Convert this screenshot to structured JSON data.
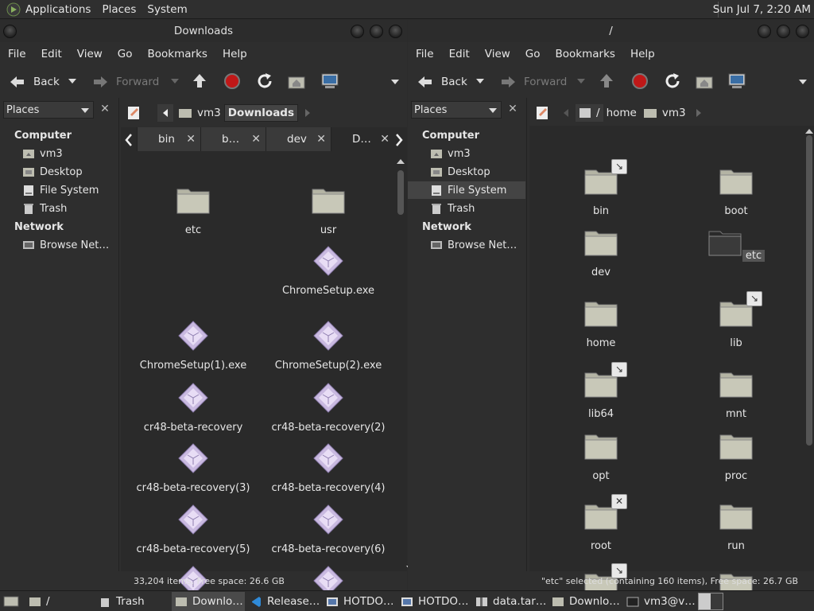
{
  "topbar": {
    "menus": [
      "Applications",
      "Places",
      "System"
    ],
    "clock": "Sun Jul  7,  2:20 AM"
  },
  "left": {
    "title": "Downloads",
    "menu": [
      "File",
      "Edit",
      "View",
      "Go",
      "Bookmarks",
      "Help"
    ],
    "toolbar": {
      "back": "Back",
      "forward": "Forward"
    },
    "places_select": "Places",
    "sidebar": {
      "computer": "Computer",
      "items": [
        "vm3",
        "Desktop",
        "File System",
        "Trash"
      ],
      "network": "Network",
      "net_items": [
        "Browse Net…"
      ]
    },
    "crumbs": [
      "vm3",
      "Downloads"
    ],
    "tabs": [
      "bin",
      "b…",
      "dev",
      "D…"
    ],
    "files": [
      "etc",
      "usr",
      "ChromeSetup.exe",
      "ChromeSetup(1).exe",
      "ChromeSetup(2).exe",
      "cr48-beta-recovery",
      "cr48-beta-recovery(2)",
      "cr48-beta-recovery(3)",
      "cr48-beta-recovery(4)",
      "cr48-beta-recovery(5)",
      "cr48-beta-recovery(6)"
    ],
    "status": "33,204 items, Free space: 26.6 GB"
  },
  "right": {
    "title": "/",
    "menu": [
      "File",
      "Edit",
      "View",
      "Go",
      "Bookmarks",
      "Help"
    ],
    "toolbar": {
      "back": "Back",
      "forward": "Forward"
    },
    "places_select": "Places",
    "sidebar": {
      "computer": "Computer",
      "items": [
        "vm3",
        "Desktop",
        "File System",
        "Trash"
      ],
      "network": "Network",
      "net_items": [
        "Browse Net…"
      ]
    },
    "crumbs": [
      "/",
      "home",
      "vm3"
    ],
    "files": [
      "bin",
      "boot",
      "dev",
      "etc",
      "home",
      "lib",
      "lib64",
      "mnt",
      "opt",
      "proc",
      "root",
      "run"
    ],
    "status": "\"etc\" selected (containing 160 items), Free space: 26.7 GB"
  },
  "taskbar": {
    "root": "/",
    "items": [
      "Trash",
      "Downlo…",
      "Release…",
      "HOTDO…",
      "HOTDO…",
      "data.tar…",
      "Downlo…",
      "vm3@v…"
    ]
  }
}
